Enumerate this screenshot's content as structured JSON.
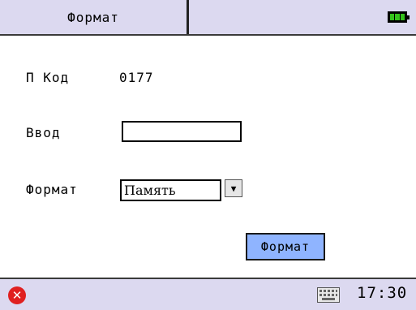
{
  "header": {
    "title": "Формат"
  },
  "form": {
    "pcode_label": "П Код",
    "pcode_value": "0177",
    "input_label": "Ввод",
    "input_value": "",
    "format_label": "Формат",
    "format_selected": "Память"
  },
  "actions": {
    "format_button": "Формат"
  },
  "status": {
    "time": "17:30"
  },
  "colors": {
    "bar_bg": "#dcd9f0",
    "button_bg": "#8fb4ff",
    "battery_fill": "#35c21c",
    "close_red": "#e02020"
  },
  "icons": [
    "battery-icon",
    "close-icon",
    "keyboard-icon",
    "dropdown-arrow-icon"
  ]
}
